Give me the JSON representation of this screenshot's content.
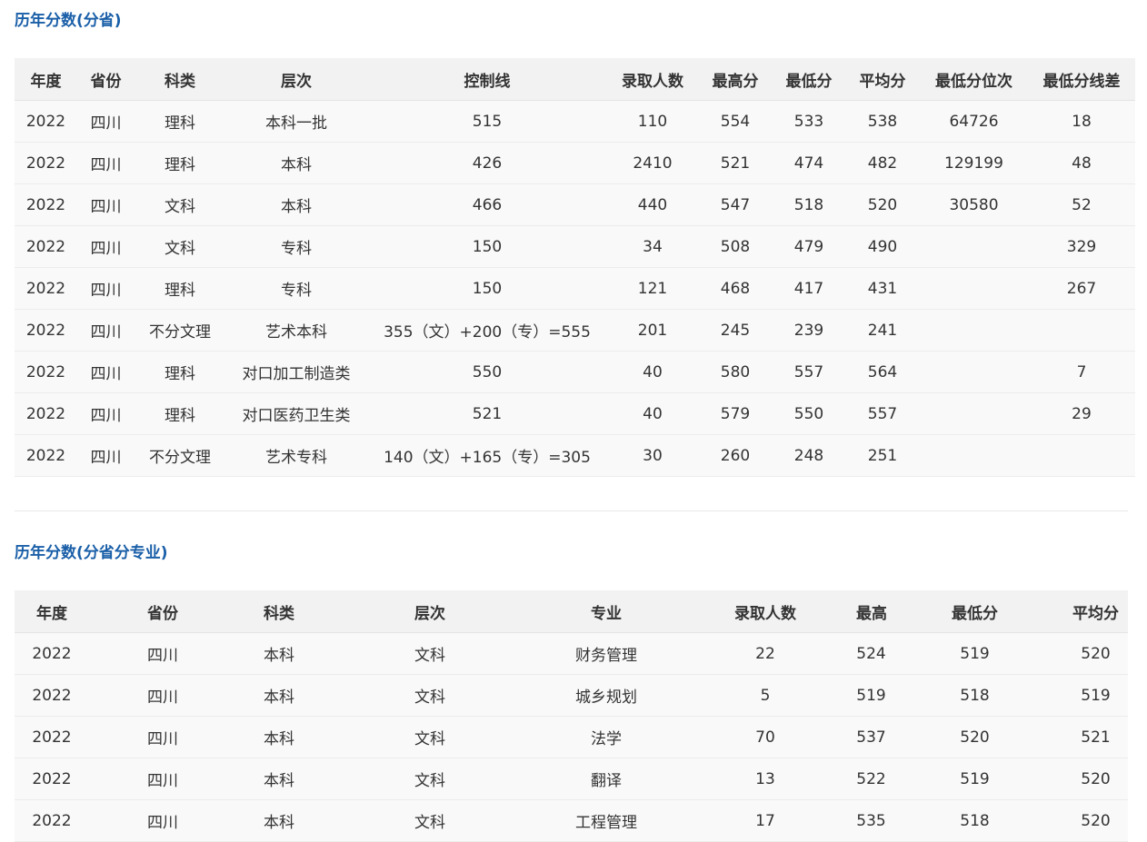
{
  "section1": {
    "title": "历年分数(分省)",
    "headers": [
      "年度",
      "省份",
      "科类",
      "层次",
      "控制线",
      "录取人数",
      "最高分",
      "最低分",
      "平均分",
      "最低分位次",
      "最低分线差"
    ],
    "rows": [
      [
        "2022",
        "四川",
        "理科",
        "本科一批",
        "515",
        "110",
        "554",
        "533",
        "538",
        "64726",
        "18"
      ],
      [
        "2022",
        "四川",
        "理科",
        "本科",
        "426",
        "2410",
        "521",
        "474",
        "482",
        "129199",
        "48"
      ],
      [
        "2022",
        "四川",
        "文科",
        "本科",
        "466",
        "440",
        "547",
        "518",
        "520",
        "30580",
        "52"
      ],
      [
        "2022",
        "四川",
        "文科",
        "专科",
        "150",
        "34",
        "508",
        "479",
        "490",
        "",
        "329"
      ],
      [
        "2022",
        "四川",
        "理科",
        "专科",
        "150",
        "121",
        "468",
        "417",
        "431",
        "",
        "267"
      ],
      [
        "2022",
        "四川",
        "不分文理",
        "艺术本科",
        "355（文）+200（专）=555",
        "201",
        "245",
        "239",
        "241",
        "",
        ""
      ],
      [
        "2022",
        "四川",
        "理科",
        "对口加工制造类",
        "550",
        "40",
        "580",
        "557",
        "564",
        "",
        "7"
      ],
      [
        "2022",
        "四川",
        "理科",
        "对口医药卫生类",
        "521",
        "40",
        "579",
        "550",
        "557",
        "",
        "29"
      ],
      [
        "2022",
        "四川",
        "不分文理",
        "艺术专科",
        "140（文）+165（专）=305",
        "30",
        "260",
        "248",
        "251",
        "",
        ""
      ]
    ]
  },
  "section2": {
    "title": "历年分数(分省分专业)",
    "headers": [
      "年度",
      "省份",
      "科类",
      "层次",
      "专业",
      "录取人数",
      "最高分",
      "最低分",
      "平均分"
    ],
    "rows": [
      [
        "2022",
        "四川",
        "本科",
        "文科",
        "财务管理",
        "22",
        "524",
        "519",
        "520"
      ],
      [
        "2022",
        "四川",
        "本科",
        "文科",
        "城乡规划",
        "5",
        "519",
        "518",
        "519"
      ],
      [
        "2022",
        "四川",
        "本科",
        "文科",
        "法学",
        "70",
        "537",
        "520",
        "521"
      ],
      [
        "2022",
        "四川",
        "本科",
        "文科",
        "翻译",
        "13",
        "522",
        "519",
        "520"
      ],
      [
        "2022",
        "四川",
        "本科",
        "文科",
        "工程管理",
        "17",
        "535",
        "518",
        "520"
      ]
    ]
  }
}
